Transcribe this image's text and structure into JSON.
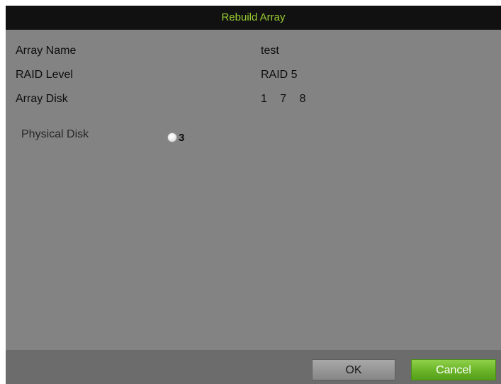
{
  "dialog": {
    "title": "Rebuild Array"
  },
  "fields": {
    "array_name": {
      "label": "Array Name",
      "value": "test"
    },
    "raid_level": {
      "label": "RAID Level",
      "value": "RAID 5"
    },
    "array_disk": {
      "label": "Array Disk",
      "value": "1  7  8"
    }
  },
  "physical_disk": {
    "label": "Physical Disk",
    "options": [
      {
        "label": "3",
        "selected": false
      }
    ]
  },
  "buttons": {
    "ok_label": "OK",
    "cancel_label": "Cancel"
  },
  "colors": {
    "title_text": "#9acd32",
    "panel_bg": "#838383",
    "titlebar_bg": "#111111",
    "cancel_accent": "#6cb62a"
  }
}
